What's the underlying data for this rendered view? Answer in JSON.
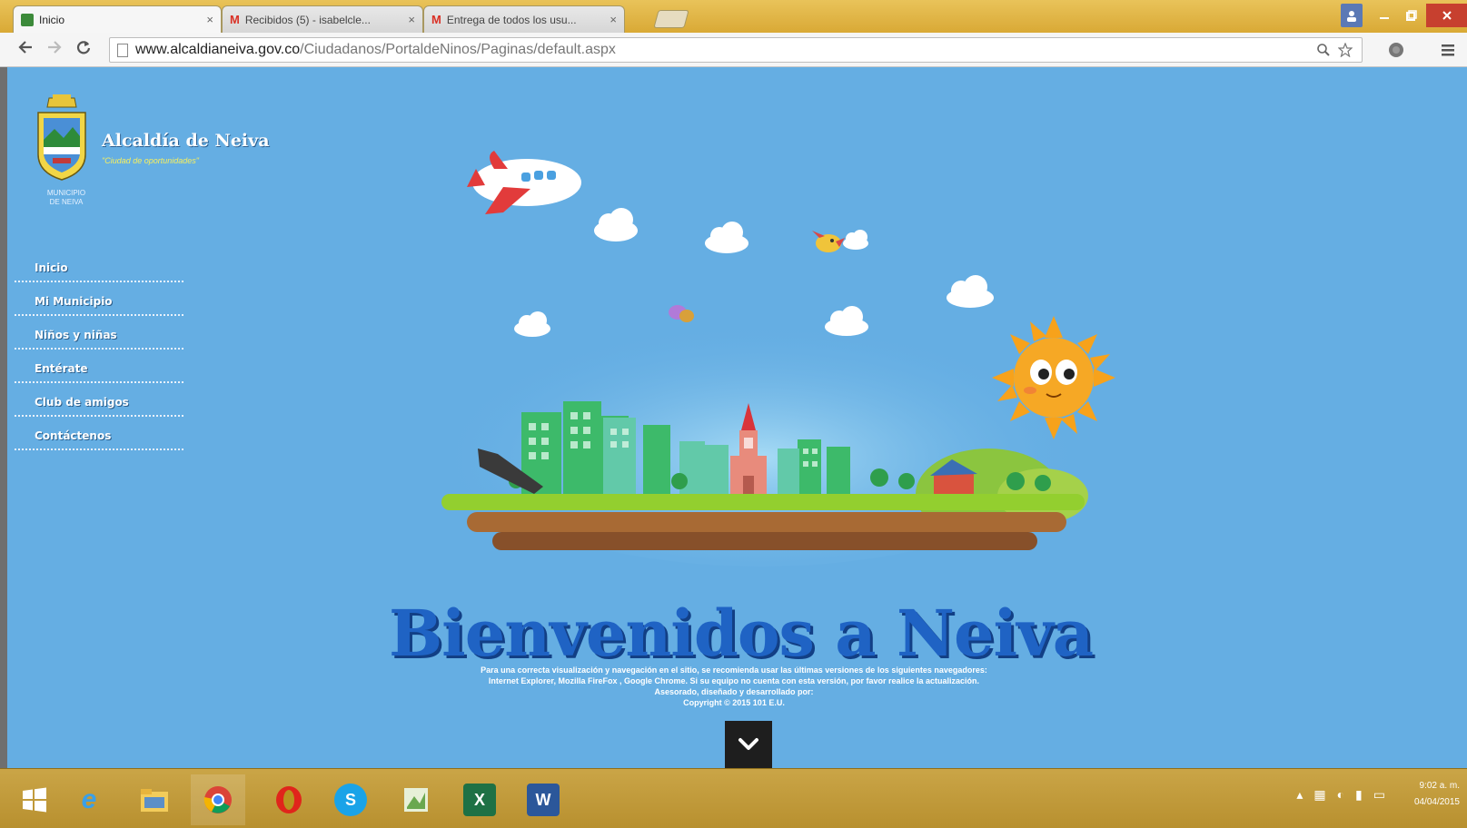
{
  "browser": {
    "tabs": [
      {
        "title": "Inicio",
        "favicon": "site-favicon",
        "active": true
      },
      {
        "title": "Recibidos (5) - isabelcle...",
        "favicon": "gmail-icon",
        "active": false
      },
      {
        "title": "Entrega de todos los usu...",
        "favicon": "gmail-icon",
        "active": false
      }
    ],
    "url_host": "www.alcaldianeiva.gov.co",
    "url_path": "/Ciudadanos/PortaldeNinos/Paginas/default.aspx",
    "close_glyph": "×",
    "gmail_glyph": "M"
  },
  "site": {
    "name": "Alcaldía de Neiva",
    "slogan": "\"Ciudad de oportunidades\"",
    "municipio": [
      "MUNICIPIO",
      "DE NEIVA"
    ]
  },
  "nav": {
    "items": [
      {
        "label": "Inicio"
      },
      {
        "label": "Mi Municipio"
      },
      {
        "label": "Niños y niñas"
      },
      {
        "label": "Entérate"
      },
      {
        "label": "Club de amigos"
      },
      {
        "label": "Contáctenos"
      }
    ]
  },
  "main": {
    "welcome": "Bienvenidos a Neiva",
    "footnote": [
      "Para una correcta visualización y navegación en el sitio, se recomienda usar las últimas versiones de los siguientes navegadores:",
      "Internet Explorer, Mozilla FireFox , Google Chrome. Si su equipo no cuenta con esta versión, por favor realice la actualización.",
      "Asesorado, diseñado y desarrollado por:",
      "Copyright © 2015 101 E.U."
    ]
  },
  "taskbar": {
    "apps": [
      "windows-start",
      "internet-explorer",
      "file-explorer",
      "chrome",
      "opera",
      "skype",
      "paint",
      "excel",
      "word"
    ],
    "clock_time": "9:02 a. m.",
    "clock_date": "04/04/2015"
  },
  "colors": {
    "page_bg": "#65aee3",
    "title_blue": "#1f63c4",
    "taskbar": "#c29b3e"
  }
}
